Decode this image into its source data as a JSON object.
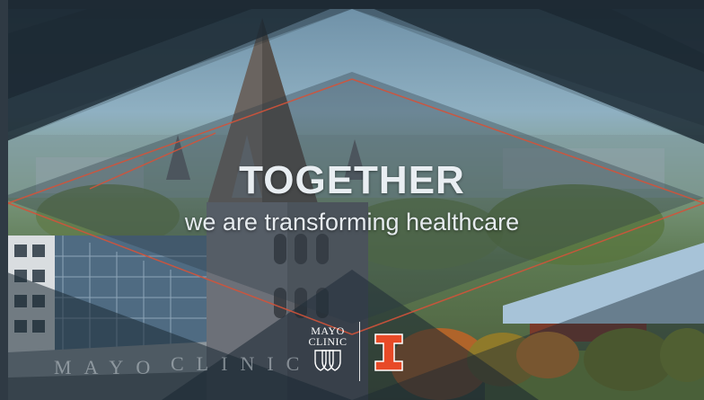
{
  "slide": {
    "title": "TOGETHER",
    "subtitle": "we are transforming healthcare"
  },
  "logos": {
    "mayo": {
      "line1": "MAYO",
      "line2": "CLINIC"
    },
    "illinois": {
      "letter": "I"
    }
  },
  "sign_text": "MAYO CLINIC",
  "colors": {
    "accent_line": "#d3533a",
    "illinois_orange": "#e84a27",
    "overlay_dark": "#1d2b36"
  }
}
